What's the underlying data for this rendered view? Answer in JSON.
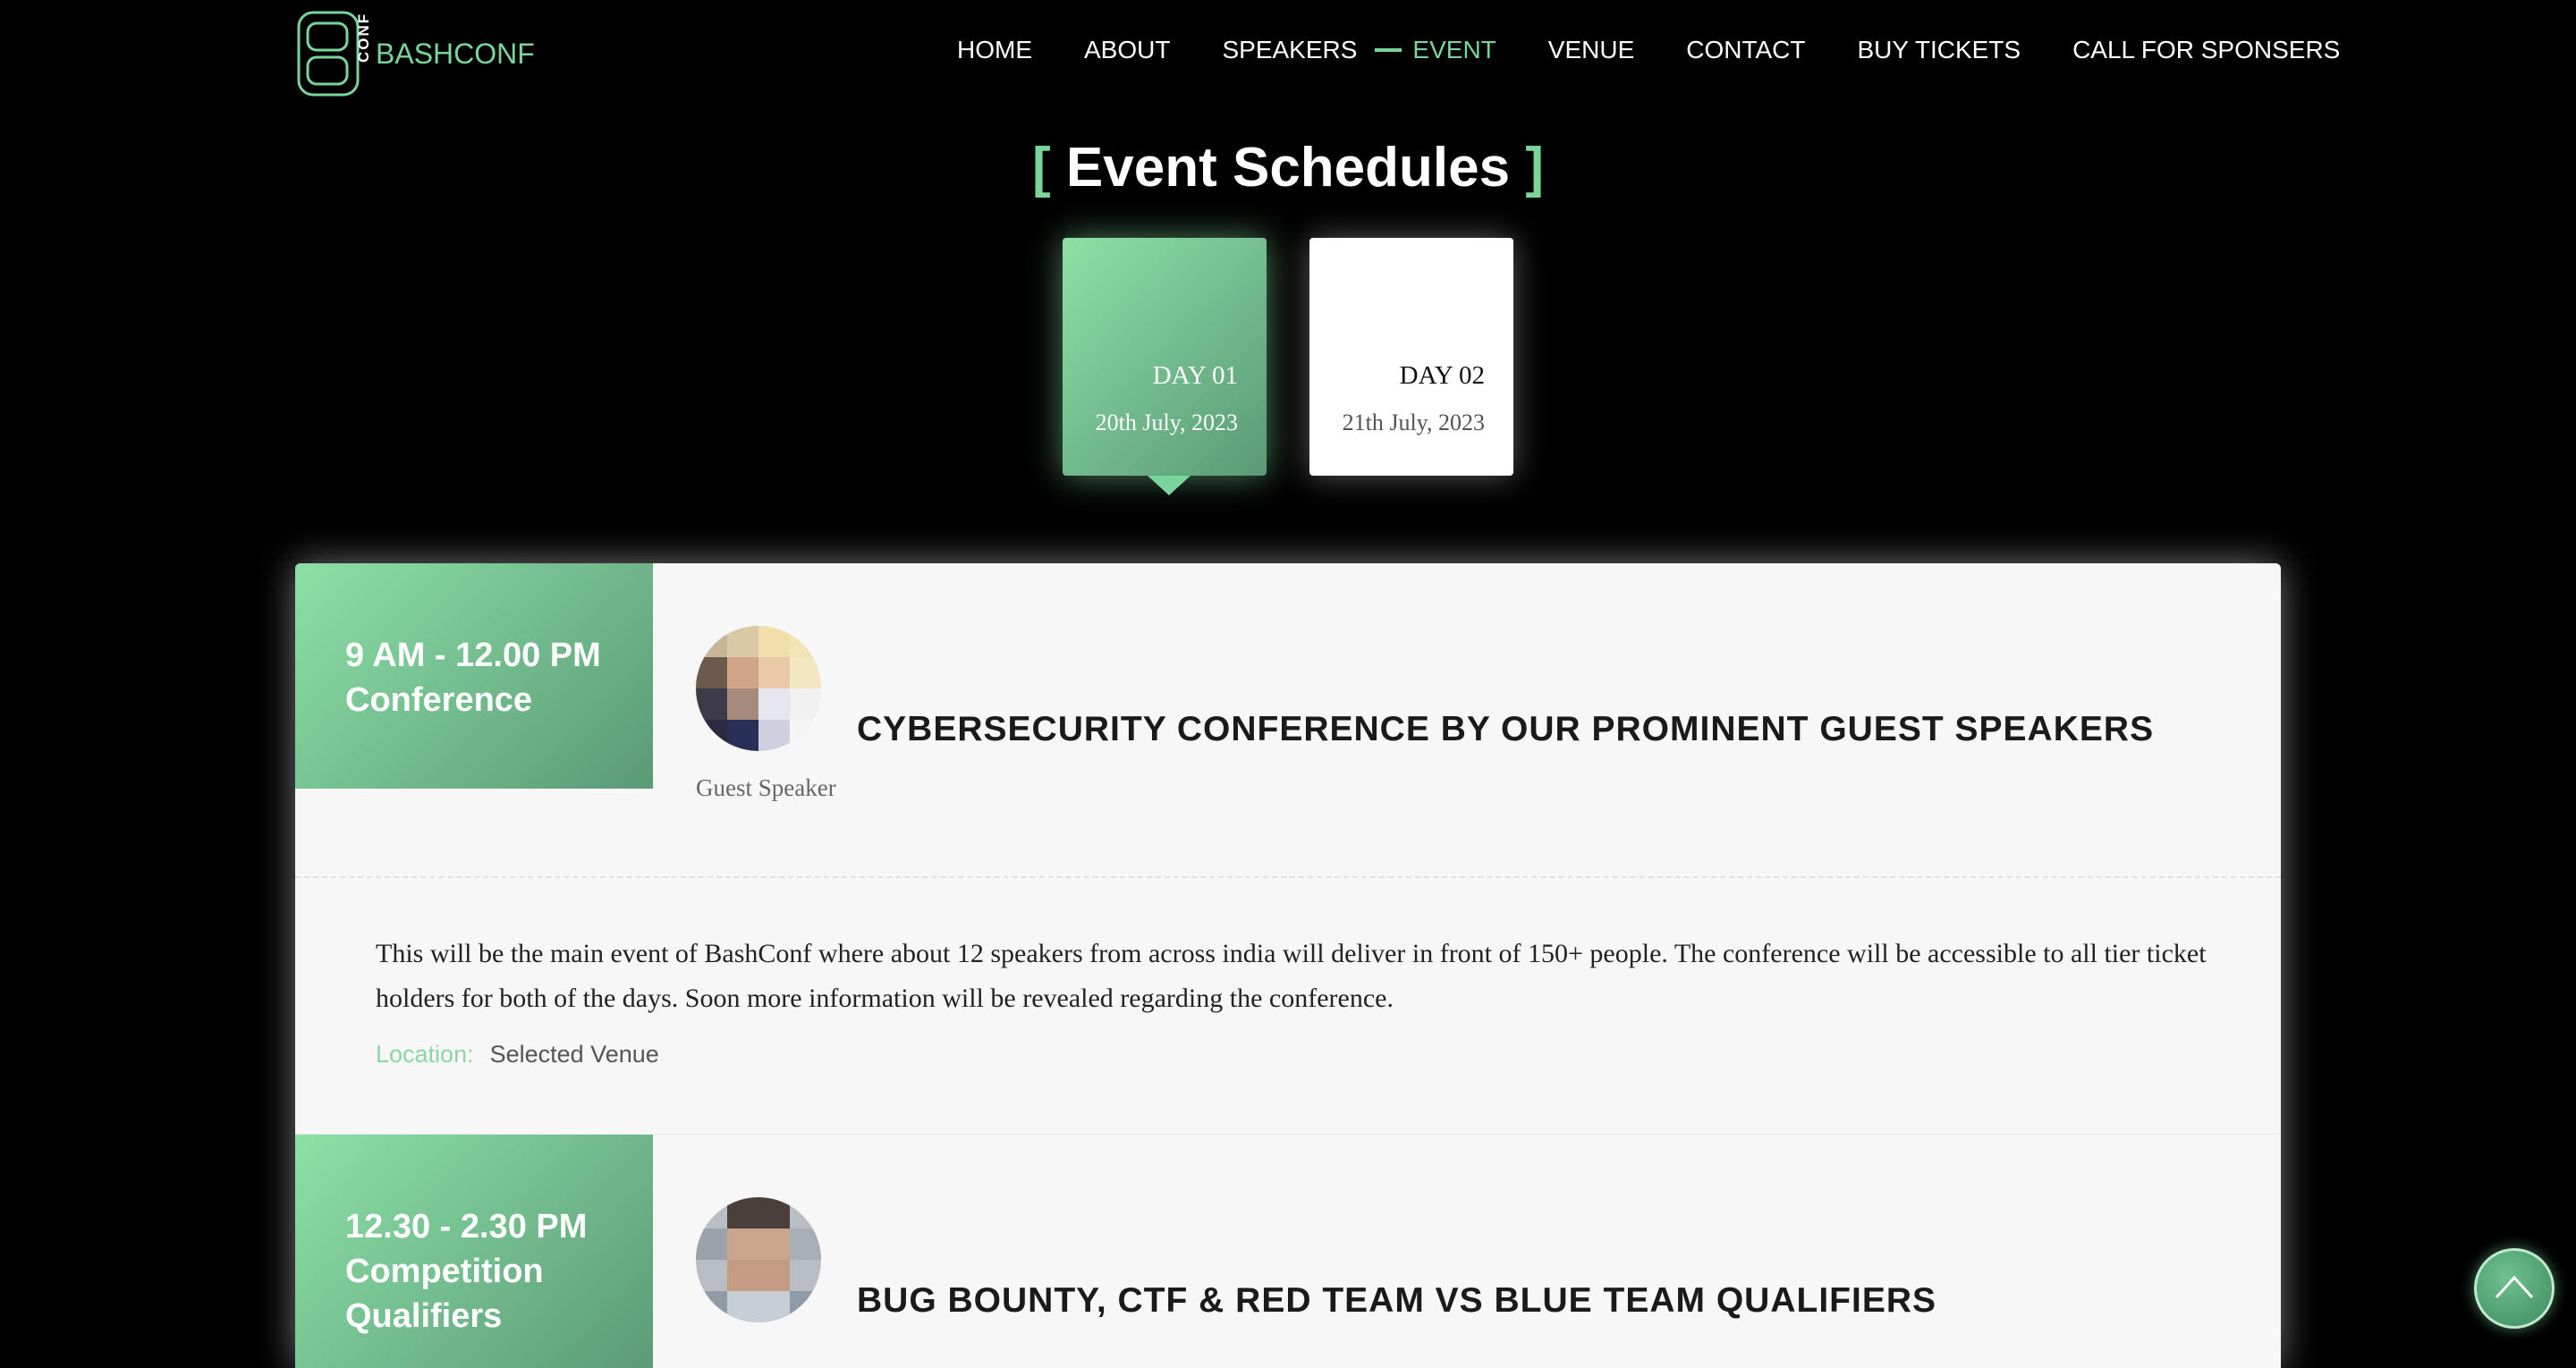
{
  "brand": {
    "name": "BASHCONF",
    "mark_letters": "CONF"
  },
  "nav": {
    "items": [
      {
        "label": "HOME",
        "active": false
      },
      {
        "label": "ABOUT",
        "active": false
      },
      {
        "label": "SPEAKERS",
        "active": false
      },
      {
        "label": "EVENT",
        "active": true
      },
      {
        "label": "VENUE",
        "active": false
      },
      {
        "label": "CONTACT",
        "active": false
      },
      {
        "label": "BUY TICKETS",
        "active": false
      },
      {
        "label": "CALL FOR SPONSERS",
        "active": false
      }
    ]
  },
  "section": {
    "title": "Event Schedules",
    "bracket_open": "[",
    "bracket_close": "]"
  },
  "days": [
    {
      "label": "DAY 01",
      "date": "20th July, 2023",
      "selected": true
    },
    {
      "label": "DAY 02",
      "date": "21th July, 2023",
      "selected": false
    }
  ],
  "schedule": [
    {
      "time": "9 AM - 12.00 PM",
      "category": "Conference",
      "title": "CYBERSECURITY CONFERENCE BY OUR PROMINENT GUEST SPEAKERS",
      "speaker_role": "Guest Speaker",
      "description": "This will be the main event of BashConf where about 12 speakers from across india will deliver in front of 150+ people. The conference will be accessible to all tier ticket holders for both of the days. Soon more information will be revealed regarding the conference.",
      "location_label": "Location:",
      "location_value": "Selected Venue"
    },
    {
      "time": "12.30 - 2.30 PM",
      "category": "Competition Qualifiers",
      "title": "BUG BOUNTY, CTF & RED TEAM VS BLUE TEAM QUALIFIERS"
    }
  ],
  "colors": {
    "accent": "#7ad59a",
    "accent_dark": "#5a9a76",
    "background": "#000000",
    "card": "#f7f7f7"
  },
  "icons": {
    "scroll_top": "chevron-up-icon"
  }
}
